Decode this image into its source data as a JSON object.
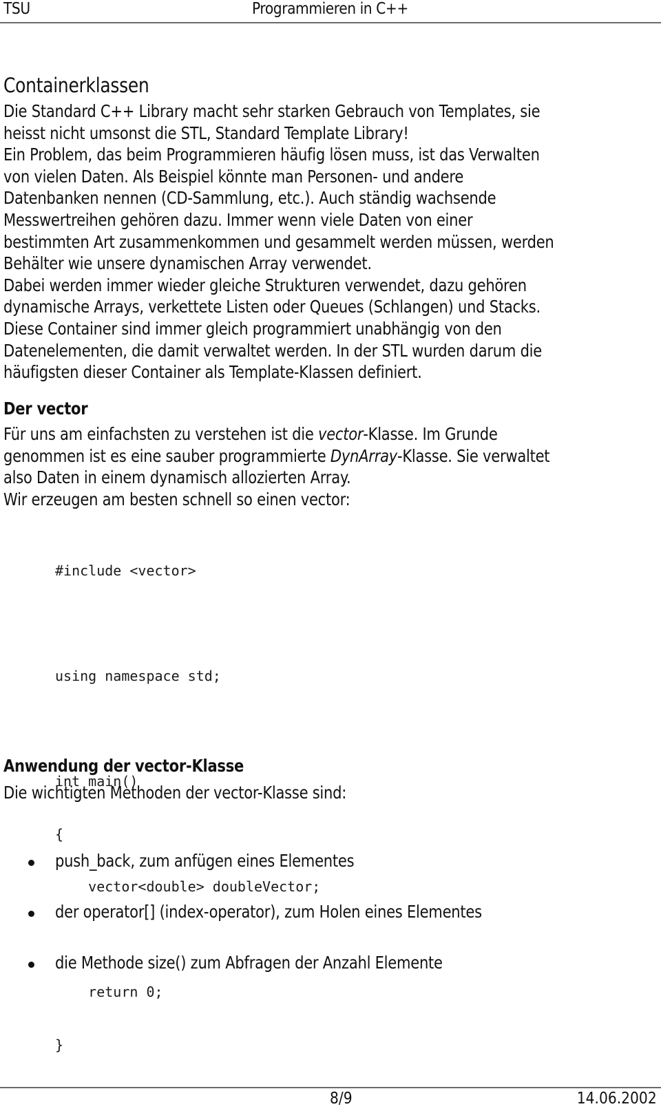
{
  "header": {
    "left": "TSU",
    "center": "Programmieren in C++"
  },
  "section1": {
    "title": "Containerklassen",
    "lines": [
      "Die Standard C++ Library macht sehr starken Gebrauch von Templates, sie",
      "heisst nicht umsonst die STL, Standard Template Library!",
      "Ein Problem, das beim Programmieren häufig lösen muss, ist das Verwalten",
      "von vielen Daten. Als Beispiel könnte man Personen- und andere",
      "Datenbanken nennen (CD-Sammlung, etc.). Auch ständig wachsende",
      "Messwertreihen gehören dazu. Immer wenn viele Daten von einer",
      "bestimmten Art zusammenkommen und gesammelt werden müssen, werden",
      "Behälter wie unsere dynamischen Array verwendet.",
      "Dabei werden immer wieder gleiche Strukturen verwendet, dazu gehören",
      "dynamische Arrays, verkettete Listen oder Queues (Schlangen) und Stacks.",
      "Diese Container sind immer gleich programmiert unabhängig von den",
      "Datenelementen, die damit verwaltet werden. In der STL wurden darum die",
      "häufigsten dieser Container als Template-Klassen definiert."
    ]
  },
  "section2": {
    "title": "Der vector",
    "line1_pre": "Für uns am einfachsten zu verstehen ist die ",
    "line1_em": "vector",
    "line1_post": "-Klasse. Im Grunde",
    "line2_pre": "genommen ist es eine sauber programmierte ",
    "line2_em": "DynArray",
    "line2_post": "-Klasse. Sie verwaltet",
    "line3": "also Daten in einem dynamisch allozierten Array.",
    "line4": "Wir erzeugen am besten schnell so einen vector:"
  },
  "code": {
    "lines": [
      "#include <vector>",
      "",
      "using namespace std;",
      "",
      "int main()",
      "{",
      "    vector<double> doubleVector;",
      "",
      "    return 0;",
      "}"
    ]
  },
  "section3": {
    "title": "Anwendung der vector-Klasse",
    "intro": "Die wichtigten Methoden der vector-Klasse sind:",
    "bullets": [
      "push_back, zum anfügen eines Elementes",
      "der operator[] (index-operator), zum Holen eines Elementes",
      "die Methode size() zum Abfragen der Anzahl Elemente"
    ]
  },
  "footer": {
    "page": "8/9",
    "date": "14.06.2002"
  }
}
